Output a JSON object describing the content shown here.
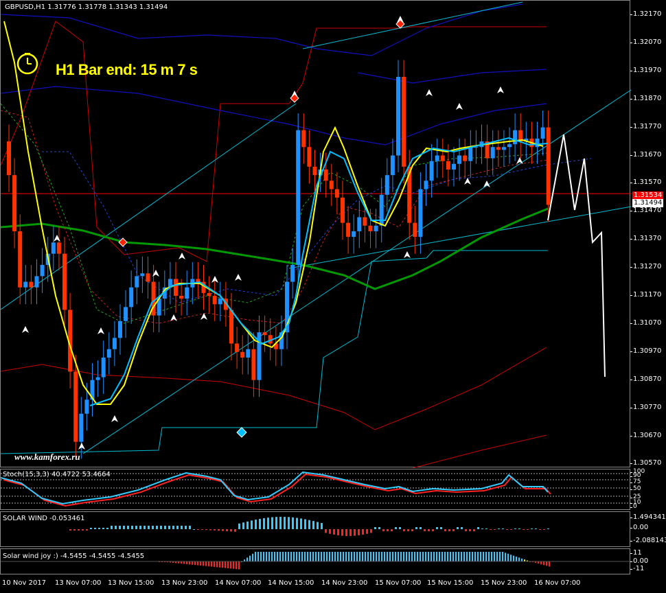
{
  "header": {
    "symbol": "GBPUSD,H1",
    "ohlc": "1.31776 1.31778 1.31343 1.31494"
  },
  "overlay": {
    "bar_end": "H1 Bar end: 15 m 7 s",
    "watermark": "www.kamforex.ru",
    "clock": "clock-icon"
  },
  "price_axis": [
    "1.32170",
    "1.32070",
    "1.31970",
    "1.31870",
    "1.31770",
    "1.31670",
    "1.31570",
    "1.31470",
    "1.31370",
    "1.31270",
    "1.31170",
    "1.31070",
    "1.30970",
    "1.30870",
    "1.30770",
    "1.30670",
    "1.30570"
  ],
  "price_tags": {
    "red_level": "1.31534",
    "current": "1.31494"
  },
  "stoch": {
    "label": "Stoch(15,3,3) 40.4722 53.4664",
    "levels": [
      "100",
      "90",
      "75",
      "50",
      "25",
      "10",
      "0"
    ]
  },
  "solar_wind": {
    "label": "SOLAR WIND -0.053461",
    "levels": [
      "1.494341",
      "0.00",
      "-2.088143"
    ]
  },
  "solar_joy": {
    "label": "Solar wind joy :) -4.5455 -4.5455 -4.5455",
    "levels": [
      "11",
      "0.00",
      "-11"
    ]
  },
  "time_axis": [
    "10 Nov 2017",
    "13 Nov 07:00",
    "13 Nov 15:00",
    "13 Nov 23:00",
    "14 Nov 07:00",
    "14 Nov 15:00",
    "14 Nov 23:00",
    "15 Nov 07:00",
    "15 Nov 15:00",
    "15 Nov 23:00",
    "16 Nov 07:00"
  ],
  "colors": {
    "bull": "#1e90ff",
    "bear": "#ff3300",
    "yellow_ma": "#ffff00",
    "cyan_ma": "#00bfff",
    "green_ma": "#009900",
    "channel": "#00bcd4",
    "envelope_red": "#cc0000",
    "envelope_blue": "#1010c0"
  },
  "chart_data": {
    "type": "candlestick",
    "symbol": "GBPUSD",
    "timeframe": "H1",
    "ylim": [
      1.3057,
      1.3222
    ],
    "current_price": 1.31494,
    "red_level": 1.31534,
    "close": [
      1.316,
      1.314,
      1.312,
      1.3122,
      1.312,
      1.3124,
      1.3128,
      1.3132,
      1.3136,
      1.3132,
      1.3112,
      1.309,
      1.3065,
      1.3075,
      1.308,
      1.3087,
      1.3088,
      1.3095,
      1.3098,
      1.3102,
      1.3108,
      1.3113,
      1.312,
      1.3124,
      1.3125,
      1.3122,
      1.311,
      1.3116,
      1.312,
      1.3123,
      1.3117,
      1.3116,
      1.312,
      1.3123,
      1.3122,
      1.3118,
      1.3117,
      1.3114,
      1.3116,
      1.3112,
      1.31,
      1.3097,
      1.3095,
      1.3098,
      1.3087,
      1.3104,
      1.3103,
      1.31,
      1.3098,
      1.3104,
      1.3122,
      1.3128,
      1.3176,
      1.317,
      1.3163,
      1.316,
      1.3162,
      1.3158,
      1.3155,
      1.3152,
      1.3143,
      1.3138,
      1.314,
      1.3145,
      1.3142,
      1.314,
      1.3142,
      1.3153,
      1.316,
      1.3167,
      1.3195,
      1.3163,
      1.3143,
      1.3138,
      1.3155,
      1.3158,
      1.3165,
      1.3167,
      1.3165,
      1.3162,
      1.3164,
      1.3167,
      1.3165,
      1.317,
      1.317,
      1.3172,
      1.3166,
      1.317,
      1.3169,
      1.317,
      1.3171,
      1.3176,
      1.3172,
      1.3173,
      1.317,
      1.3173,
      1.3177,
      1.31494
    ]
  }
}
